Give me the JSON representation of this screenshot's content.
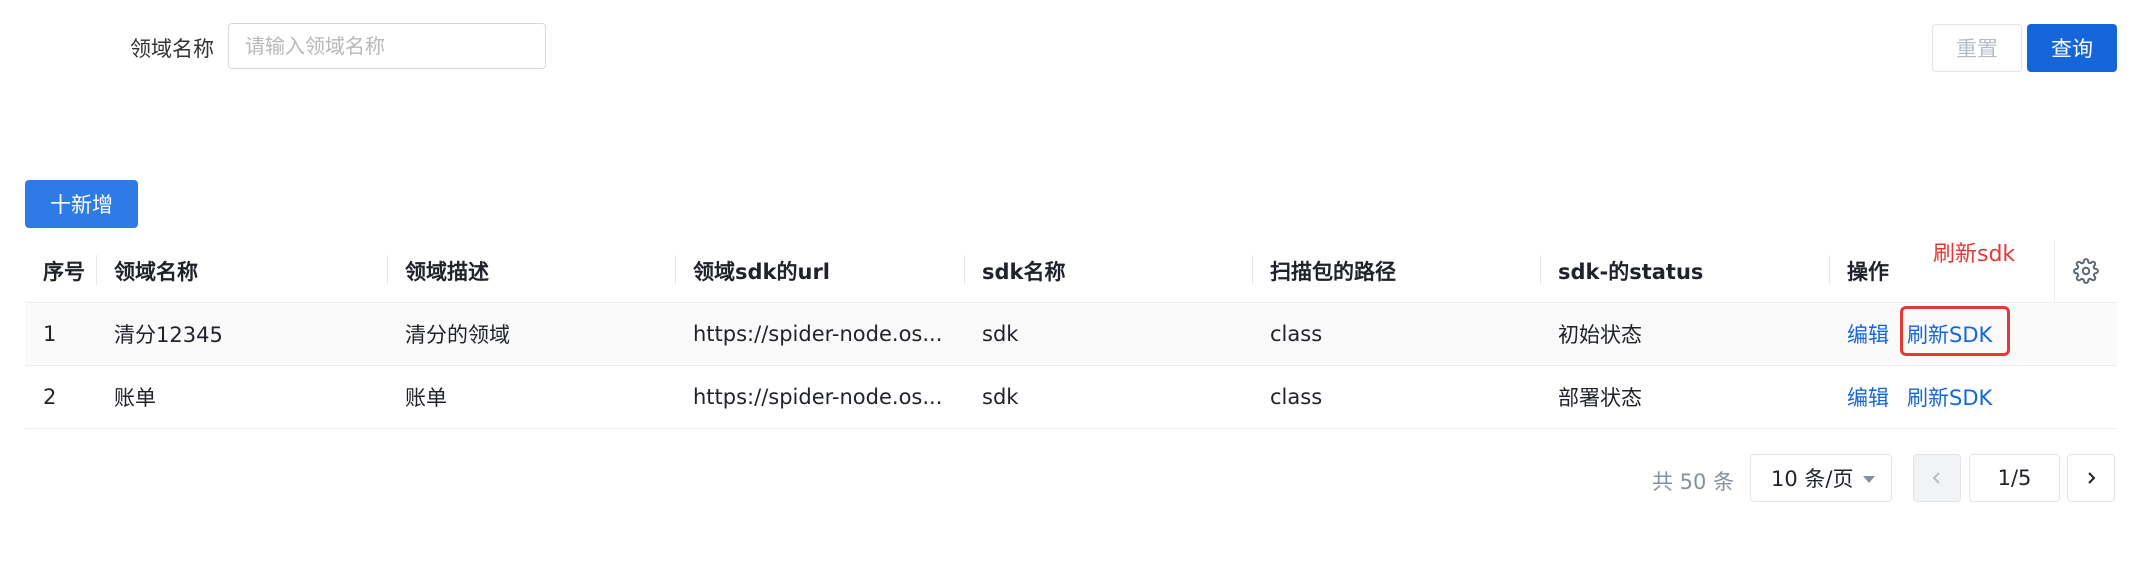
{
  "filter": {
    "label": "领域名称",
    "placeholder": "请输入领域名称",
    "value": "",
    "reset_label": "重置",
    "query_label": "查询"
  },
  "toolbar": {
    "add_label": "十新增"
  },
  "table": {
    "headers": {
      "index": "序号",
      "name": "领域名称",
      "desc": "领域描述",
      "url": "领域sdk的url",
      "sdk": "sdk名称",
      "path": "扫描包的路径",
      "status": "sdk-的status",
      "ops": "操作"
    },
    "rows": [
      {
        "index": "1",
        "name": "清分12345",
        "desc": "清分的领域",
        "url": "https://spider-node.os...",
        "sdk": "sdk",
        "path": "class",
        "status": "初始状态",
        "edit": "编辑",
        "refresh": "刷新SDK"
      },
      {
        "index": "2",
        "name": "账单",
        "desc": "账单",
        "url": "https://spider-node.os...",
        "sdk": "sdk",
        "path": "class",
        "status": "部署状态",
        "edit": "编辑",
        "refresh": "刷新SDK"
      }
    ],
    "settings_icon": "gear-icon"
  },
  "annotation": {
    "text": "刷新sdk",
    "color": "#e53935"
  },
  "pagination": {
    "total": "共 50 条",
    "page_size": "10 条/页",
    "current": "1/5"
  },
  "colors": {
    "primary": "#1466d9",
    "add_button": "#2f7be6",
    "link": "#1466d9"
  }
}
